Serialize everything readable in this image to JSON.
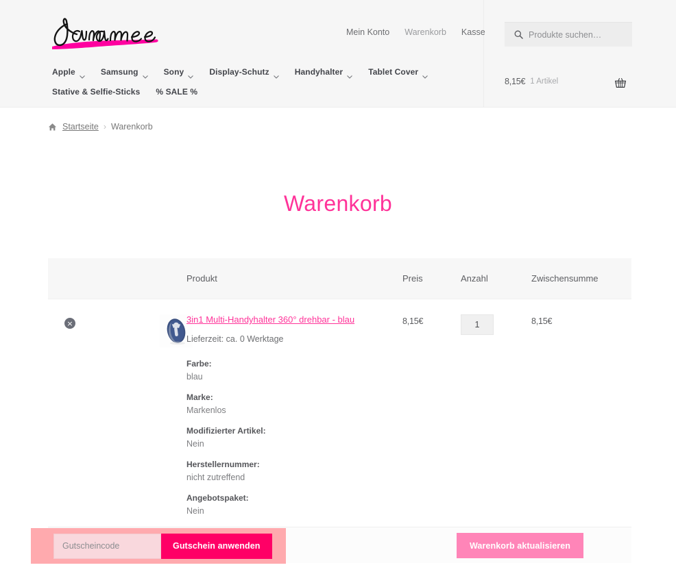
{
  "header": {
    "logo_text": "Baramee",
    "secondary_nav": [
      {
        "label": "Mein Konto",
        "dim": false
      },
      {
        "label": "Warenkorb",
        "dim": true
      },
      {
        "label": "Kasse",
        "dim": false
      }
    ],
    "search": {
      "placeholder": "Produkte suchen…",
      "value": "",
      "icon": "search-icon"
    },
    "primary_nav": [
      {
        "label": "Apple",
        "has_caret": true
      },
      {
        "label": "Samsung",
        "has_caret": true
      },
      {
        "label": "Sony",
        "has_caret": true
      },
      {
        "label": "Display-Schutz",
        "has_caret": true
      },
      {
        "label": "Handyhalter",
        "has_caret": true
      },
      {
        "label": "Tablet Cover",
        "has_caret": true
      },
      {
        "label": "Stative & Selfie-Sticks",
        "has_caret": false
      },
      {
        "label": "% SALE %",
        "has_caret": false
      }
    ],
    "cart": {
      "amount": "8,15€",
      "count": "1 Artikel",
      "icon": "shopping-basket-icon"
    }
  },
  "breadcrumb": {
    "home_icon": "home-icon",
    "items": [
      {
        "label": "Startseite",
        "link": true
      },
      {
        "label": "Warenkorb",
        "link": false
      }
    ],
    "separator": "›"
  },
  "page": {
    "title": "Warenkorb"
  },
  "cart_table": {
    "columns": [
      "",
      "",
      "Produkt",
      "Preis",
      "Anzahl",
      "Zwischensumme"
    ],
    "headers": {
      "product": "Produkt",
      "price": "Preis",
      "quantity": "Anzahl",
      "subtotal": "Zwischensumme"
    },
    "rows": [
      {
        "remove_label": "×",
        "thumbnail": "product-thumbnail-phone-holder-blue",
        "name": "3in1 Multi-Handyhalter 360° drehbar - blau",
        "delivery": "Lieferzeit: ca. 0 Werktage",
        "attributes": [
          {
            "label": "Farbe:",
            "value": "blau"
          },
          {
            "label": "Marke:",
            "value": "Markenlos"
          },
          {
            "label": "Modifizierter Artikel:",
            "value": "Nein"
          },
          {
            "label": "Herstellernummer:",
            "value": "nicht zutreffend"
          },
          {
            "label": "Angebotspaket:",
            "value": "Nein"
          }
        ],
        "price": "8,15€",
        "quantity": "1",
        "subtotal": "8,15€"
      }
    ]
  },
  "actions": {
    "coupon_placeholder": "Gutscheincode",
    "coupon_value": "",
    "apply_coupon_label": "Gutschein anwenden",
    "update_cart_label": "Warenkorb aktualisieren"
  },
  "colors": {
    "accent_pink": "#ff3399",
    "coupon_button": "#ff0066",
    "update_button": "#ff85b8",
    "highlight": "#ffaaae",
    "header_bg": "#f6f6f6",
    "table_head_bg": "#f7f7f7"
  }
}
